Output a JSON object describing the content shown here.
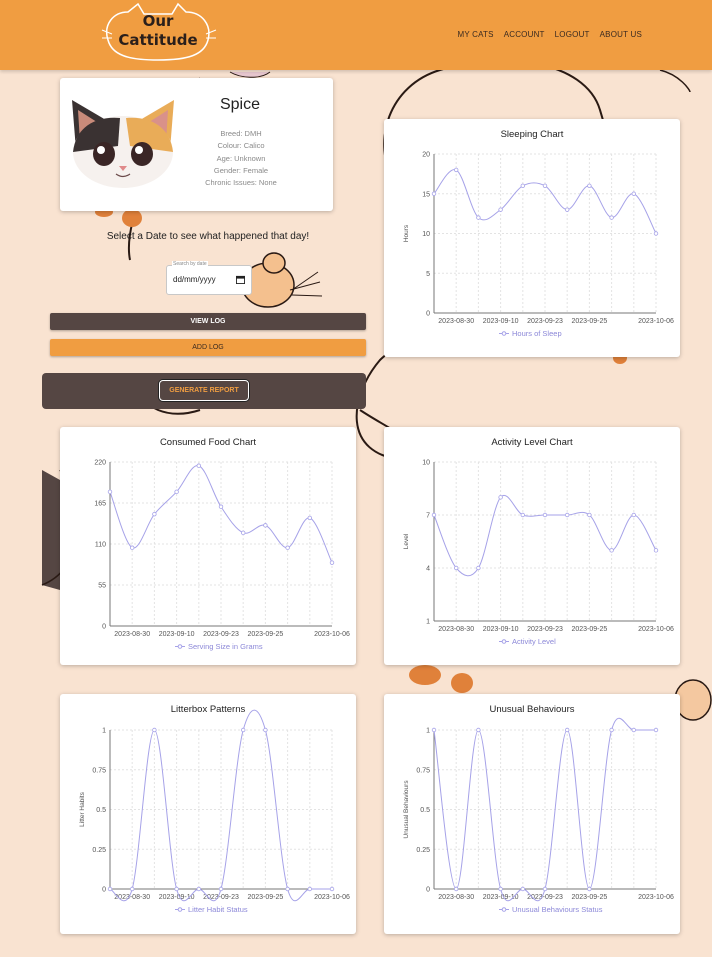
{
  "colors": {
    "accent": "#f09d41",
    "dark": "#554643",
    "line": "#a6a2e8",
    "background": "#f9e3d1"
  },
  "header": {
    "logo_line1": "Our",
    "logo_line2": "Cattitude",
    "nav": [
      "MY CATS",
      "ACCOUNT",
      "LOGOUT",
      "ABOUT US"
    ]
  },
  "profile": {
    "name": "Spice",
    "breed": "Breed: DMH",
    "colour": "Colour: Calico",
    "age": "Age: Unknown",
    "gender": "Gender: Female",
    "chronic": "Chronic Issues: None"
  },
  "log": {
    "select_message": "Select a Date to see what happened that day!",
    "date_label": "Search by date",
    "date_value": "dd/mm/yyyy",
    "view_button": "VIEW LOG",
    "add_button": "ADD LOG",
    "report_button": "GENERATE REPORT"
  },
  "charts": {
    "sleep": {
      "title": "Sleeping Chart",
      "ylabel": "Hours",
      "legend": "Hours of Sleep",
      "ymin": 0,
      "ymax": 20,
      "yticks": [
        0,
        5,
        10,
        15,
        20
      ],
      "xticks": [
        "2023-08-30",
        "2023-09-10",
        "2023-09-23",
        "2023-09-25",
        "2023-10-06"
      ],
      "values": [
        15,
        18,
        12,
        13,
        16,
        16,
        13,
        16,
        12,
        15,
        10
      ]
    },
    "food": {
      "title": "Consumed Food Chart",
      "ylabel": "",
      "legend": "Serving Size in Grams",
      "ymin": 0,
      "ymax": 220,
      "yticks": [
        0,
        55,
        110,
        165,
        220
      ],
      "xticks": [
        "2023-08-30",
        "2023-09-10",
        "2023-09-23",
        "2023-09-25",
        "2023-10-06"
      ],
      "values": [
        180,
        105,
        150,
        180,
        215,
        160,
        125,
        135,
        105,
        145,
        85
      ]
    },
    "activity": {
      "title": "Activity Level Chart",
      "ylabel": "Level",
      "legend": "Activity Level",
      "ymin": 1,
      "ymax": 10,
      "yticks": [
        1,
        4,
        7,
        10
      ],
      "xticks": [
        "2023-08-30",
        "2023-09-10",
        "2023-09-23",
        "2023-09-25",
        "2023-10-06"
      ],
      "values": [
        7,
        4,
        4,
        8,
        7,
        7,
        7,
        7,
        5,
        7,
        5
      ]
    },
    "litter": {
      "title": "Litterbox Patterns",
      "ylabel": "Litter Habits",
      "legend": "Litter Habit Status",
      "ymin": 0,
      "ymax": 1,
      "yticks": [
        0,
        0.25,
        0.5,
        0.75,
        1
      ],
      "xticks": [
        "2023-08-30",
        "2023-09-10",
        "2023-09-23",
        "2023-09-25",
        "2023-10-06"
      ],
      "values": [
        0,
        0,
        1,
        0,
        0,
        0,
        1,
        1,
        0,
        0,
        0
      ]
    },
    "unusual": {
      "title": "Unusual Behaviours",
      "ylabel": "Unusual Behaviours",
      "legend": "Unusual Behaviours Status",
      "ymin": 0,
      "ymax": 1,
      "yticks": [
        0,
        0.25,
        0.5,
        0.75,
        1
      ],
      "xticks": [
        "2023-08-30",
        "2023-09-10",
        "2023-09-23",
        "2023-09-25",
        "2023-10-06"
      ],
      "values": [
        1,
        0,
        1,
        0,
        0,
        0,
        1,
        0,
        1,
        1,
        1
      ]
    }
  }
}
